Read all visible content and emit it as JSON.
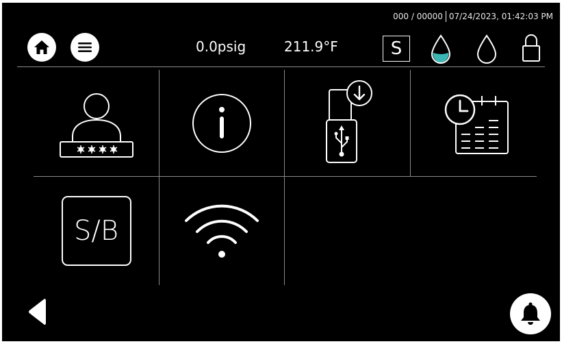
{
  "header": {
    "id_counter": "000 / 00000",
    "datetime": "07/24/2023, 01:42:03 PM",
    "pressure": "0.0psig",
    "temperature": "211.9°F",
    "mode_letter": "S",
    "left_buttons": [
      {
        "name": "home-button",
        "icon": "home-icon"
      },
      {
        "name": "menu-button",
        "icon": "hamburger-menu-icon"
      }
    ],
    "status_icons": [
      "water-drop-filled-icon",
      "water-drop-outline-icon",
      "padlock-icon"
    ],
    "accent_color": "#3bb7b5"
  },
  "menu_tiles": [
    {
      "name": "user-password-tile",
      "icon": "user-password-icon"
    },
    {
      "name": "info-tile",
      "icon": "info-icon"
    },
    {
      "name": "usb-download-tile",
      "icon": "usb-download-icon"
    },
    {
      "name": "date-time-tile",
      "icon": "clock-calendar-icon"
    },
    {
      "name": "standby-tile",
      "icon": "standby-icon",
      "label": "S/B"
    },
    {
      "name": "wifi-tile",
      "icon": "wifi-icon"
    }
  ],
  "footer": {
    "back_icon": "back-arrow-icon",
    "alarm_icon": "bell-icon"
  }
}
